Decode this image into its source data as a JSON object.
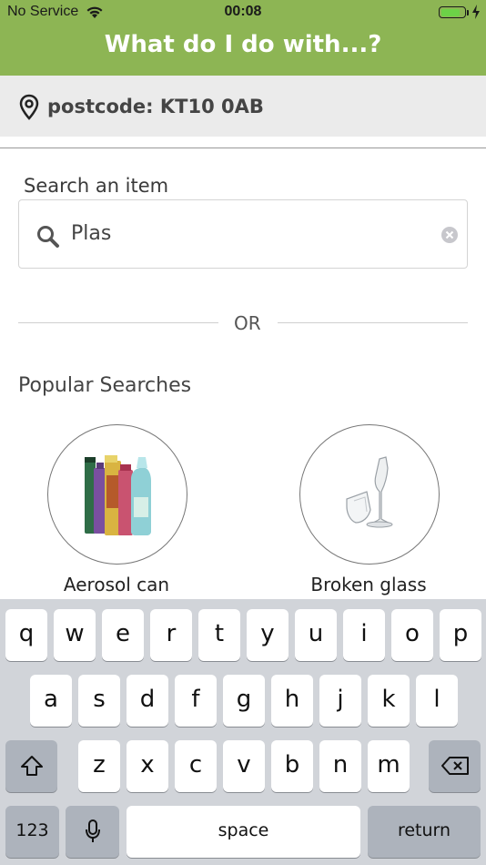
{
  "status_bar": {
    "carrier": "No Service",
    "time": "00:08",
    "battery_level": 0.85
  },
  "header": {
    "title": "What do I do with...?"
  },
  "postcode": {
    "text": "postcode: KT10 0AB"
  },
  "search": {
    "label": "Search an item",
    "value": "Plas"
  },
  "separator": {
    "text": "OR"
  },
  "popular": {
    "title": "Popular Searches",
    "items": [
      {
        "label": "Aerosol can"
      },
      {
        "label": "Broken glass"
      }
    ]
  },
  "keyboard": {
    "row1": [
      "q",
      "w",
      "e",
      "r",
      "t",
      "y",
      "u",
      "i",
      "o",
      "p"
    ],
    "row2": [
      "a",
      "s",
      "d",
      "f",
      "g",
      "h",
      "j",
      "k",
      "l"
    ],
    "row3": [
      "z",
      "x",
      "c",
      "v",
      "b",
      "n",
      "m"
    ],
    "numbers_key": "123",
    "space_key": "space",
    "return_key": "return"
  },
  "colors": {
    "header_green": "#8db554",
    "postcode_bar": "#ebebeb",
    "keyboard_bg": "#d1d4d9"
  }
}
